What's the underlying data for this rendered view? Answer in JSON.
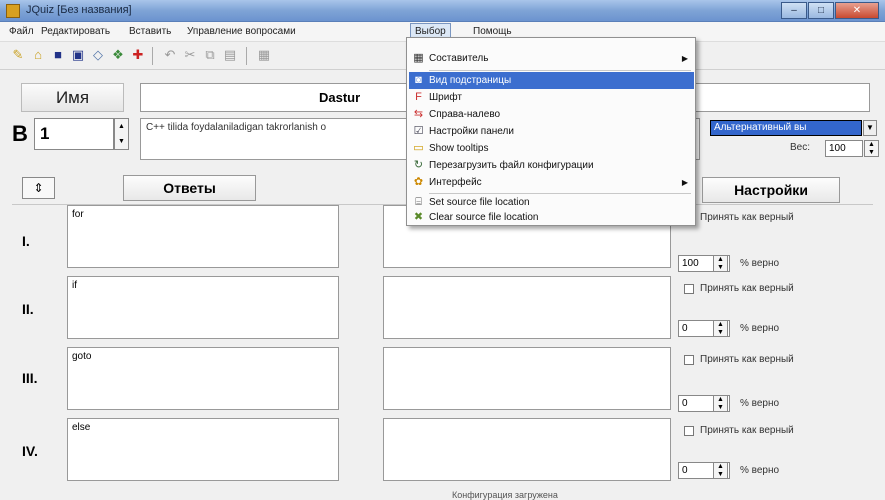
{
  "window": {
    "title": "JQuiz [Без названия]",
    "buttons": [
      "–",
      "□",
      "✕"
    ]
  },
  "menubar": {
    "items": [
      "Файл",
      "Редактировать",
      "Вставить",
      "Управление вопросами",
      "Выбор",
      "Помощь"
    ]
  },
  "toolbar": {
    "icons": [
      "new-icon",
      "open-icon",
      "save-icon",
      "save-as-icon",
      "link-icon",
      "export-icon",
      "add-icon",
      "undo-icon",
      "cut-icon",
      "copy-icon",
      "paste-icon",
      "view-icon"
    ]
  },
  "form": {
    "name_label": "Имя",
    "name_value": "Dastur",
    "question_prefix": "В",
    "question_number": "1",
    "question_text": "C++ tilida foydalaniladigan takrorlanish o",
    "question_type": "Альтернативный вы",
    "weight_label": "Вес:",
    "weight_value": "100"
  },
  "headers": {
    "answers": "Ответы",
    "settings": "Настройки"
  },
  "answers": [
    {
      "roman": "I.",
      "text": "for",
      "correct_label": "Принять как верный",
      "percent": "100",
      "percent_label": "% верно"
    },
    {
      "roman": "II.",
      "text": "if",
      "correct_label": "Принять как верный",
      "percent": "0",
      "percent_label": "% верно"
    },
    {
      "roman": "III.",
      "text": "goto",
      "correct_label": "Принять как верный",
      "percent": "0",
      "percent_label": "% верно"
    },
    {
      "roman": "IV.",
      "text": "else",
      "correct_label": "Принять как верный",
      "percent": "0",
      "percent_label": "% верно"
    }
  ],
  "menu": {
    "items": [
      {
        "label": "Составитель",
        "submenu": true
      },
      {
        "label": "Вид подстраницы",
        "highlighted": true
      },
      {
        "label": "Шрифт"
      },
      {
        "label": "Справа-налево"
      },
      {
        "label": "Настройки панели"
      },
      {
        "label": "Show tooltips"
      },
      {
        "label": "Перезагрузить файл конфигурации"
      },
      {
        "label": "Интерфейс",
        "submenu": true
      },
      {
        "label": "Set source file location"
      },
      {
        "label": "Clear source file location"
      }
    ]
  },
  "status": {
    "text": "Конфигурация загружена"
  },
  "colors": {
    "title_bar": "#7fa4d6",
    "highlight": "#3c6ecf",
    "question_type_bg": "#3366cc"
  }
}
